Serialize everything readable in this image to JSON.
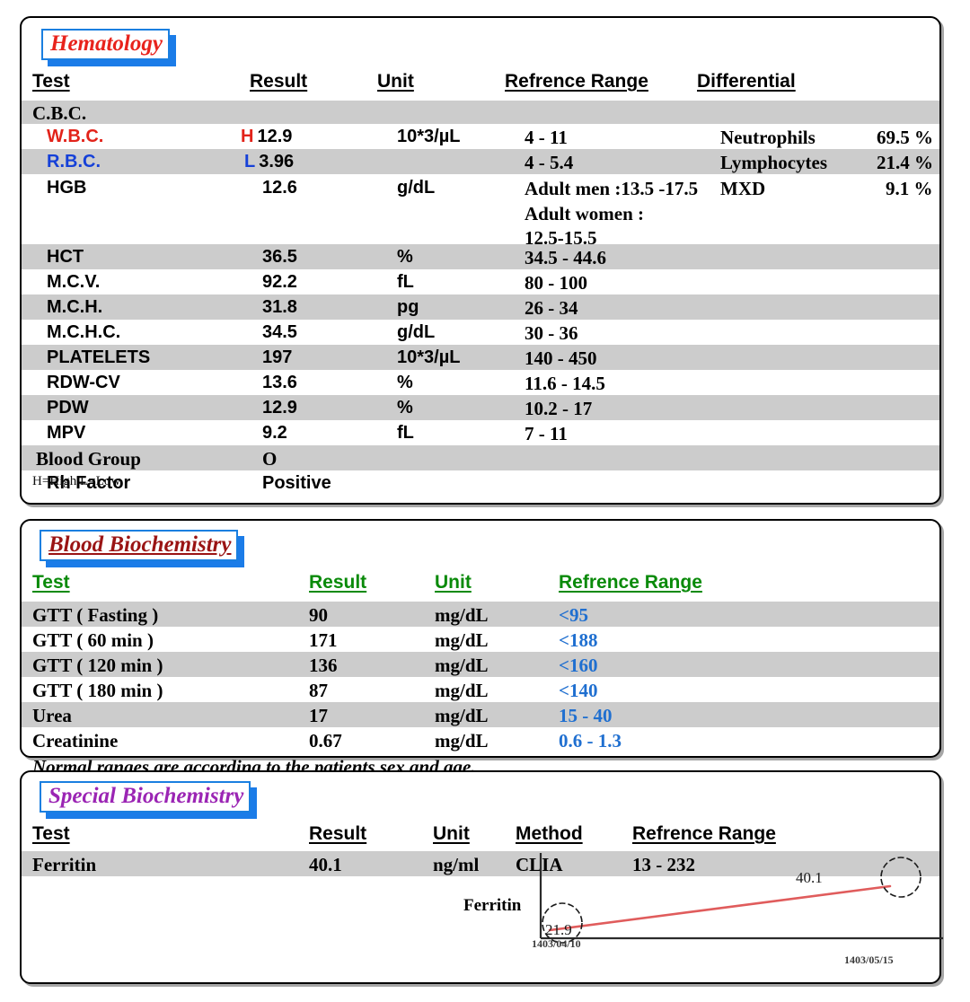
{
  "report": {
    "sections": [
      {
        "id": "hematology",
        "title": "Hematology",
        "headers": [
          "Test",
          "Result",
          "Unit",
          "Refrence Range",
          "Differential"
        ],
        "group_label": "C.B.C.",
        "legend": "H=High    L=Low",
        "rows": [
          {
            "test": "W.B.C.",
            "flag": "H",
            "result": "12.9",
            "unit": "10*3/µL",
            "ref": "4 - 11",
            "diff_name": "Neutrophils",
            "diff_value": "69.5 %",
            "color": "red"
          },
          {
            "test": "R.B.C.",
            "flag": "L",
            "result": "3.96",
            "unit": "",
            "ref": "4 - 5.4",
            "diff_name": "Lymphocytes",
            "diff_value": "21.4 %",
            "color": "blue"
          },
          {
            "test": "HGB",
            "flag": "",
            "result": "12.6",
            "unit": "g/dL",
            "ref": "Adult men :13.5 -17.5\nAdult women :\n12.5-15.5",
            "diff_name": "MXD",
            "diff_value": "9.1 %",
            "color": "black"
          },
          {
            "test": "HCT",
            "flag": "",
            "result": "36.5",
            "unit": "%",
            "ref": "34.5 - 44.6",
            "diff_name": "",
            "diff_value": "",
            "color": "black"
          },
          {
            "test": "M.C.V.",
            "flag": "",
            "result": "92.2",
            "unit": "fL",
            "ref": "80 - 100",
            "diff_name": "",
            "diff_value": "",
            "color": "black"
          },
          {
            "test": "M.C.H.",
            "flag": "",
            "result": "31.8",
            "unit": "pg",
            "ref": "26 - 34",
            "diff_name": "",
            "diff_value": "",
            "color": "black"
          },
          {
            "test": "M.C.H.C.",
            "flag": "",
            "result": "34.5",
            "unit": "g/dL",
            "ref": "30 - 36",
            "diff_name": "",
            "diff_value": "",
            "color": "black"
          },
          {
            "test": "PLATELETS",
            "flag": "",
            "result": "197",
            "unit": "10*3/µL",
            "ref": "140 - 450",
            "diff_name": "",
            "diff_value": "",
            "color": "black"
          },
          {
            "test": "RDW-CV",
            "flag": "",
            "result": "13.6",
            "unit": "%",
            "ref": "11.6 - 14.5",
            "diff_name": "",
            "diff_value": "",
            "color": "black"
          },
          {
            "test": "PDW",
            "flag": "",
            "result": "12.9",
            "unit": "%",
            "ref": "10.2 - 17",
            "diff_name": "",
            "diff_value": "",
            "color": "black"
          },
          {
            "test": "MPV",
            "flag": "",
            "result": "9.2",
            "unit": "fL",
            "ref": "7 - 11",
            "diff_name": "",
            "diff_value": "",
            "color": "black"
          },
          {
            "test": "Blood Group",
            "flag": "",
            "result": "O",
            "unit": "",
            "ref": "",
            "diff_name": "",
            "diff_value": "",
            "color": "black"
          },
          {
            "test": "Rh Factor",
            "flag": "",
            "result": "Positive",
            "unit": "",
            "ref": "",
            "diff_name": "",
            "diff_value": "",
            "color": "black"
          }
        ]
      },
      {
        "id": "biochem",
        "title": "Blood Biochemistry",
        "headers": [
          "Test",
          "Result",
          "Unit",
          "Refrence Range"
        ],
        "note": "Normal ranges are according to the patients sex and age.",
        "rows": [
          {
            "test": "GTT ( Fasting )",
            "result": "90",
            "unit": "mg/dL",
            "ref": "<95"
          },
          {
            "test": "GTT ( 60 min )",
            "result": "171",
            "unit": "mg/dL",
            "ref": "<188"
          },
          {
            "test": "GTT ( 120 min )",
            "result": "136",
            "unit": "mg/dL",
            "ref": "<160"
          },
          {
            "test": "GTT ( 180 min )",
            "result": "87",
            "unit": "mg/dL",
            "ref": "<140"
          },
          {
            "test": "Urea",
            "result": "17",
            "unit": "mg/dL",
            "ref": "15 - 40"
          },
          {
            "test": "Creatinine",
            "result": "0.67",
            "unit": "mg/dL",
            "ref": "0.6 - 1.3"
          }
        ]
      },
      {
        "id": "special",
        "title": "Special Biochemistry",
        "headers": [
          "Test",
          "Result",
          "Unit",
          "Method",
          "Refrence Range"
        ],
        "rows": [
          {
            "test": "Ferritin",
            "result": "40.1",
            "unit": "ng/ml",
            "method": "CLIA",
            "ref": "13 - 232"
          }
        ]
      }
    ]
  },
  "chart_data": {
    "type": "line",
    "title": "",
    "ylabel": "Ferritin",
    "xlabel": "",
    "x": [
      "1403/04/10",
      "1403/05/15"
    ],
    "values": [
      21.9,
      40.1
    ],
    "point_labels": [
      "21.9",
      "40.1"
    ],
    "series": [
      {
        "name": "Ferritin",
        "values": [
          21.9,
          40.1
        ]
      }
    ],
    "line_color": "#e05c5c",
    "axis_color": "#333333",
    "grid": false,
    "legend": "none",
    "ylim": [
      0,
      48
    ]
  },
  "colors": {
    "zebra": "#cccccc",
    "hematology_title": "#e8231c",
    "biochem_title": "#9a1414",
    "special_title": "#9b25b4",
    "biochem_header": "#0a8a0a",
    "biochem_ref": "#1f6fd0",
    "high_flag": "#e2231a",
    "low_flag": "#1540d8",
    "chip_border": "#1a7fe0"
  }
}
